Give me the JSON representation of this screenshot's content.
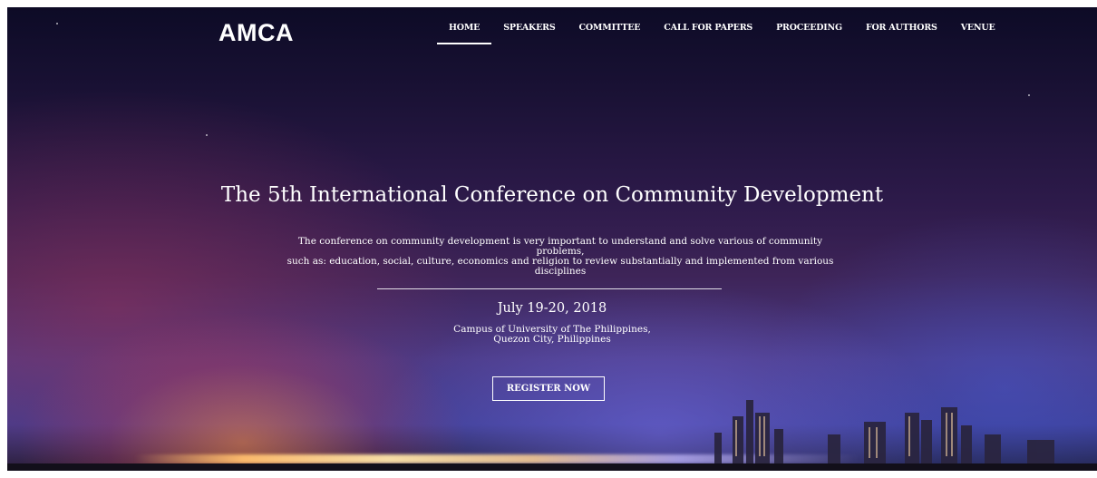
{
  "brand": {
    "logo": "AMCA"
  },
  "nav": {
    "items": [
      {
        "label": "HOME",
        "active": true
      },
      {
        "label": "SPEAKERS",
        "active": false
      },
      {
        "label": "COMMITTEE",
        "active": false
      },
      {
        "label": "CALL FOR PAPERS",
        "active": false
      },
      {
        "label": "PROCEEDING",
        "active": false
      },
      {
        "label": "FOR AUTHORS",
        "active": false
      },
      {
        "label": "VENUE",
        "active": false
      }
    ]
  },
  "hero": {
    "title": "The 5th International Conference on Community Development",
    "description_lines": [
      "The conference on community development is very important to understand and solve various of community problems,",
      "such as: education, social, culture, economics and religion to review substantially and implemented from various",
      "disciplines"
    ],
    "date": "July 19-20, 2018",
    "venue_lines": [
      "Campus of University of The Philippines,",
      "Quezon City, Philippines"
    ],
    "register_label": "REGISTER NOW"
  },
  "colors": {
    "text": "#ffffff",
    "sky_top": "#0d0b26",
    "sky_mid": "#3e2458",
    "city_glow_warm": "#ff8c3c",
    "city_glow_cool": "#786ee6"
  }
}
